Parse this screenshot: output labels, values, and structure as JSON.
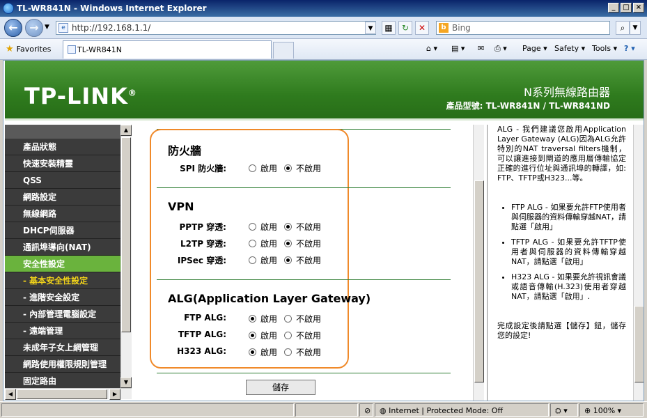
{
  "window": {
    "title": "TL-WR841N - Windows Internet Explorer"
  },
  "address_bar": {
    "url": "http://192.168.1.1/",
    "search_placeholder": "Bing"
  },
  "favorites_bar": {
    "favorites_label": "Favorites",
    "tab_title": "TL-WR841N",
    "commands": {
      "page": "Page",
      "safety": "Safety",
      "tools": "Tools"
    }
  },
  "banner": {
    "logo": "TP-LINK",
    "product": "N系列無線路由器",
    "model": "產品型號: TL-WR841N / TL-WR841ND"
  },
  "menu": {
    "items": [
      {
        "label": "產品狀態"
      },
      {
        "label": "快速安裝精靈"
      },
      {
        "label": "QSS"
      },
      {
        "label": "網路設定"
      },
      {
        "label": "無線網路"
      },
      {
        "label": "DHCP伺服器"
      },
      {
        "label": "通訊埠導向(NAT)"
      },
      {
        "label": "安全性設定"
      },
      {
        "label": "- 基本安全性設定"
      },
      {
        "label": "- 進階安全設定"
      },
      {
        "label": "- 內部管理電腦設定"
      },
      {
        "label": "- 遠端管理"
      },
      {
        "label": "未成年子女上網管理"
      },
      {
        "label": "網路使用權限規則管理"
      },
      {
        "label": "固定路由"
      }
    ]
  },
  "main": {
    "enable": "啟用",
    "disable": "不啟用",
    "firewall": {
      "title": "防火牆",
      "spi_label": "SPI 防火牆:"
    },
    "vpn": {
      "title": "VPN",
      "pptp_label": "PPTP 穿透:",
      "l2tp_label": "L2TP 穿透:",
      "ipsec_label": "IPSec 穿透:"
    },
    "alg": {
      "title": "ALG(Application Layer Gateway)",
      "ftp_label": "FTP ALG:",
      "tftp_label": "TFTP ALG:",
      "h323_label": "H323 ALG:"
    },
    "save_label": "儲存"
  },
  "help": {
    "intro": "ALG - 我們建議您啟用Application Layer Gateway (ALG)因為ALG允許特別的NAT traversal filters機制，可以讓進接到閘道的應用層傳輸協定正確的進行位址與通訊埠的轉譯，如: FTP、TFTP或H323...等。",
    "ftp": "FTP ALG - 如果要允許FTP使用者與伺服器的資料傳輸穿越NAT，請點選「啟用」",
    "tftp": "TFTP ALG - 如果要允許TFTP使用者與伺服器的資料傳輸穿越NAT，請點選「啟用」",
    "h323": "H323 ALG - 如果要允許視訊會議或語音傳輸(H.323)使用者穿越NAT，請點選「啟用」.",
    "done": "完成設定後請點選【儲存】鈕，儲存您的設定!"
  },
  "status_bar": {
    "zone": "Internet | Protected Mode: Off",
    "zoom": "100%"
  }
}
